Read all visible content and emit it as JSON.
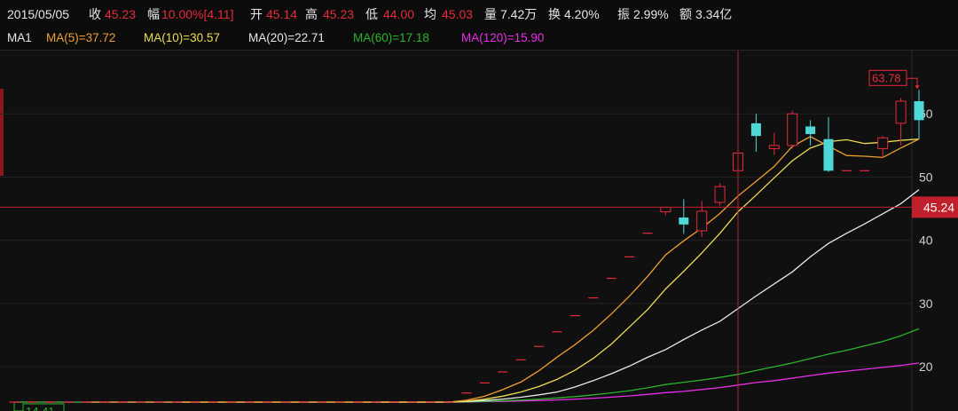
{
  "info_bar": {
    "date": "2015/05/05",
    "close_label": "收",
    "close": "45.23",
    "change_label": "幅",
    "change": "10.00%[4.11]",
    "open_label": "开",
    "open": "45.14",
    "high_label": "高",
    "high": "45.23",
    "low_label": "低",
    "low": "44.00",
    "avg_label": "均",
    "avg": "45.03",
    "volume_label": "量",
    "volume": "7.42万",
    "turnover_label": "换",
    "turnover": "4.20%",
    "amplitude_label": "振",
    "amplitude": "2.99%",
    "amount_label": "额",
    "amount": "3.34亿"
  },
  "ma_bar": {
    "group": "MA1",
    "ma5": "MA(5)=37.72",
    "ma10": "MA(10)=30.57",
    "ma20": "MA(20)=22.71",
    "ma60": "MA(60)=17.18",
    "ma120": "MA(120)=15.90"
  },
  "colors": {
    "up": "#e8293c",
    "down": "#4fd8d8",
    "flat": "#e8293c",
    "ma5": "#f0a030",
    "ma10": "#ecdc50",
    "ma20": "#e8e8e8",
    "ma60": "#2ab42a",
    "ma120": "#e82ee8",
    "grid": "#232323",
    "crosshair": "#c0202c",
    "price_tag_bg": "#c0202c"
  },
  "chart_data": {
    "type": "candlestick",
    "ylim": [
      13,
      70
    ],
    "yticks": [
      20,
      30,
      40,
      50,
      60
    ],
    "max_label": "63.78",
    "min_label": "14.41",
    "crosshair_price": "45.24",
    "crosshair_index": 40,
    "candles": [
      {
        "o": 14.41,
        "h": 14.41,
        "l": 14.41,
        "c": 14.41
      },
      {
        "o": 14.41,
        "h": 14.41,
        "l": 14.41,
        "c": 14.41
      },
      {
        "o": 14.41,
        "h": 14.41,
        "l": 14.41,
        "c": 14.41
      },
      {
        "o": 14.41,
        "h": 14.41,
        "l": 14.41,
        "c": 14.41
      },
      {
        "o": 14.41,
        "h": 14.41,
        "l": 14.41,
        "c": 14.41
      },
      {
        "o": 14.41,
        "h": 14.41,
        "l": 14.41,
        "c": 14.41
      },
      {
        "o": 14.41,
        "h": 14.41,
        "l": 14.41,
        "c": 14.41
      },
      {
        "o": 14.41,
        "h": 14.41,
        "l": 14.41,
        "c": 14.41
      },
      {
        "o": 14.41,
        "h": 14.41,
        "l": 14.41,
        "c": 14.41
      },
      {
        "o": 14.41,
        "h": 14.41,
        "l": 14.41,
        "c": 14.41
      },
      {
        "o": 14.41,
        "h": 14.41,
        "l": 14.41,
        "c": 14.41
      },
      {
        "o": 14.41,
        "h": 14.41,
        "l": 14.41,
        "c": 14.41
      },
      {
        "o": 14.41,
        "h": 14.41,
        "l": 14.41,
        "c": 14.41
      },
      {
        "o": 14.41,
        "h": 14.41,
        "l": 14.41,
        "c": 14.41
      },
      {
        "o": 14.41,
        "h": 14.41,
        "l": 14.41,
        "c": 14.41
      },
      {
        "o": 14.41,
        "h": 14.41,
        "l": 14.41,
        "c": 14.41
      },
      {
        "o": 14.41,
        "h": 14.41,
        "l": 14.41,
        "c": 14.41
      },
      {
        "o": 14.41,
        "h": 14.41,
        "l": 14.41,
        "c": 14.41
      },
      {
        "o": 14.41,
        "h": 14.41,
        "l": 14.41,
        "c": 14.41
      },
      {
        "o": 14.41,
        "h": 14.41,
        "l": 14.41,
        "c": 14.41
      },
      {
        "o": 14.41,
        "h": 14.41,
        "l": 14.41,
        "c": 14.41
      },
      {
        "o": 14.41,
        "h": 14.41,
        "l": 14.41,
        "c": 14.41
      },
      {
        "o": 14.41,
        "h": 14.41,
        "l": 14.41,
        "c": 14.41
      },
      {
        "o": 14.41,
        "h": 14.41,
        "l": 14.41,
        "c": 14.41
      },
      {
        "o": 14.41,
        "h": 14.41,
        "l": 14.41,
        "c": 14.41
      },
      {
        "o": 15.85,
        "h": 15.85,
        "l": 15.85,
        "c": 15.85
      },
      {
        "o": 17.44,
        "h": 17.44,
        "l": 17.44,
        "c": 17.44
      },
      {
        "o": 19.18,
        "h": 19.18,
        "l": 19.18,
        "c": 19.18
      },
      {
        "o": 21.1,
        "h": 21.1,
        "l": 21.1,
        "c": 21.1
      },
      {
        "o": 23.21,
        "h": 23.21,
        "l": 23.21,
        "c": 23.21
      },
      {
        "o": 25.53,
        "h": 25.53,
        "l": 25.53,
        "c": 25.53
      },
      {
        "o": 28.08,
        "h": 28.08,
        "l": 28.08,
        "c": 28.08
      },
      {
        "o": 30.89,
        "h": 30.89,
        "l": 30.89,
        "c": 30.89
      },
      {
        "o": 33.98,
        "h": 33.98,
        "l": 33.98,
        "c": 33.98
      },
      {
        "o": 37.38,
        "h": 37.38,
        "l": 37.38,
        "c": 37.38
      },
      {
        "o": 41.12,
        "h": 41.12,
        "l": 41.12,
        "c": 41.12
      },
      {
        "o": 44.5,
        "h": 45.23,
        "l": 44.0,
        "c": 45.23
      },
      {
        "o": 43.6,
        "h": 46.5,
        "l": 41.0,
        "c": 42.5
      },
      {
        "o": 41.5,
        "h": 46.2,
        "l": 40.5,
        "c": 44.6
      },
      {
        "o": 46.0,
        "h": 49.0,
        "l": 45.5,
        "c": 48.5
      },
      {
        "o": 51.0,
        "h": 54.3,
        "l": 50.5,
        "c": 53.8
      },
      {
        "o": 58.5,
        "h": 60.0,
        "l": 54.0,
        "c": 56.5
      },
      {
        "o": 54.5,
        "h": 57.0,
        "l": 53.5,
        "c": 55.0
      },
      {
        "o": 55.0,
        "h": 60.5,
        "l": 54.5,
        "c": 60.0
      },
      {
        "o": 58.0,
        "h": 59.0,
        "l": 55.0,
        "c": 56.8
      },
      {
        "o": 56.0,
        "h": 59.5,
        "l": 50.8,
        "c": 51.0
      },
      {
        "o": 51.0,
        "h": 51.0,
        "l": 51.0,
        "c": 51.0
      },
      {
        "o": 51.0,
        "h": 51.0,
        "l": 51.0,
        "c": 51.0
      },
      {
        "o": 54.5,
        "h": 56.5,
        "l": 53.0,
        "c": 56.2
      },
      {
        "o": 58.5,
        "h": 62.5,
        "l": 55.0,
        "c": 62.0
      },
      {
        "o": 62.0,
        "h": 63.78,
        "l": 56.0,
        "c": 59.0
      }
    ],
    "ma": {
      "ma5": [
        null,
        null,
        null,
        null,
        14.41,
        14.41,
        14.41,
        14.41,
        14.41,
        14.41,
        14.41,
        14.41,
        14.41,
        14.41,
        14.41,
        14.41,
        14.41,
        14.41,
        14.41,
        14.41,
        14.41,
        14.41,
        14.41,
        14.41,
        14.41,
        14.7,
        15.33,
        16.38,
        17.57,
        19.38,
        21.52,
        23.51,
        25.76,
        28.34,
        31.17,
        34.29,
        37.7,
        39.91,
        41.93,
        44.24,
        47.0,
        49.32,
        51.68,
        54.85,
        56.4,
        54.9,
        53.4,
        53.3,
        53.1,
        54.6,
        56.0
      ],
      "ma10": [
        null,
        null,
        null,
        null,
        null,
        null,
        null,
        null,
        null,
        14.41,
        14.41,
        14.41,
        14.41,
        14.41,
        14.41,
        14.41,
        14.41,
        14.41,
        14.41,
        14.41,
        14.41,
        14.41,
        14.41,
        14.41,
        14.41,
        14.56,
        14.87,
        15.35,
        16.0,
        16.87,
        18.0,
        19.47,
        21.32,
        23.59,
        26.29,
        29.03,
        32.3,
        35.1,
        38.01,
        41.1,
        44.51,
        47.15,
        49.88,
        52.58,
        54.6,
        55.6,
        55.9,
        55.3,
        55.5,
        55.8,
        56.0
      ],
      "ma20": [
        null,
        null,
        null,
        null,
        null,
        null,
        null,
        null,
        null,
        null,
        null,
        null,
        null,
        null,
        null,
        null,
        null,
        null,
        null,
        null,
        14.41,
        14.41,
        14.41,
        14.41,
        14.41,
        14.5,
        14.65,
        14.88,
        15.18,
        15.55,
        16.0,
        16.8,
        17.8,
        18.9,
        20.1,
        21.5,
        22.71,
        24.3,
        25.8,
        27.2,
        29.2,
        31.2,
        33.1,
        35.0,
        37.4,
        39.5,
        41.1,
        42.6,
        44.2,
        45.8,
        48.0
      ],
      "ma60": [
        14.41,
        14.41,
        14.41,
        14.41,
        14.41,
        14.41,
        14.41,
        14.41,
        14.41,
        14.41,
        14.41,
        14.41,
        14.41,
        14.41,
        14.41,
        14.41,
        14.41,
        14.41,
        14.41,
        14.41,
        14.41,
        14.41,
        14.41,
        14.41,
        14.41,
        14.45,
        14.52,
        14.61,
        14.73,
        14.88,
        15.06,
        15.28,
        15.55,
        15.86,
        16.22,
        16.66,
        17.18,
        17.55,
        17.9,
        18.3,
        18.8,
        19.4,
        20.0,
        20.6,
        21.3,
        22.0,
        22.6,
        23.3,
        24.0,
        24.9,
        26.0
      ],
      "ma120": [
        14.41,
        14.41,
        14.41,
        14.41,
        14.41,
        14.41,
        14.41,
        14.41,
        14.41,
        14.41,
        14.41,
        14.41,
        14.41,
        14.41,
        14.41,
        14.41,
        14.41,
        14.41,
        14.41,
        14.41,
        14.41,
        14.41,
        14.41,
        14.41,
        14.41,
        14.43,
        14.47,
        14.52,
        14.58,
        14.66,
        14.76,
        14.88,
        15.02,
        15.19,
        15.39,
        15.63,
        15.9,
        16.1,
        16.4,
        16.7,
        17.1,
        17.5,
        17.8,
        18.2,
        18.6,
        19.0,
        19.3,
        19.6,
        19.9,
        20.2,
        20.6
      ]
    }
  }
}
